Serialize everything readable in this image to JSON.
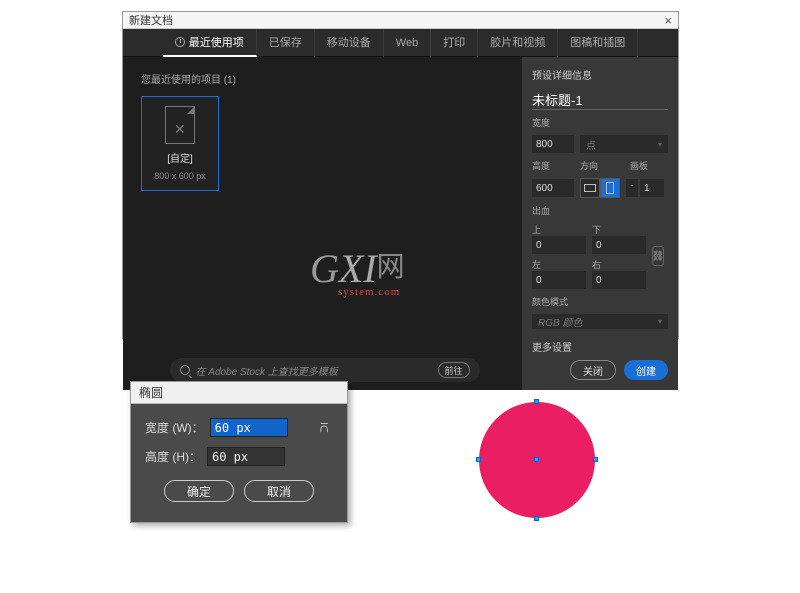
{
  "dialog": {
    "title": "新建文档",
    "close": "×",
    "tabs": {
      "recent": "最近使用项",
      "saved": "已保存",
      "mobile": "移动设备",
      "web": "Web",
      "print": "打印",
      "film": "胶片和视频",
      "art": "图稿和插图"
    },
    "recent_label": "您最近使用的项目 (1)",
    "preset": {
      "name": "[自定]",
      "dim": "800 x 600 px"
    },
    "search": {
      "placeholder": "在 Adobe Stock 上查找更多模板",
      "go": "前往"
    },
    "details": {
      "section": "预设详细信息",
      "name": "未标题-1",
      "width_lbl": "宽度",
      "width": "800",
      "unit": "点",
      "height_lbl": "高度",
      "height": "600",
      "orient_lbl": "方向",
      "artboards_lbl": "画板",
      "artboards": "1",
      "bleed_lbl": "出血",
      "top_lbl": "上",
      "bottom_lbl": "下",
      "left_lbl": "左",
      "right_lbl": "右",
      "top": "0",
      "bottom": "0",
      "left": "0",
      "right": "0",
      "colormode_lbl": "颜色模式",
      "colormode": "RGB 颜色",
      "more": "更多设置"
    },
    "buttons": {
      "close": "关闭",
      "create": "创建"
    }
  },
  "ellipse": {
    "title": "椭圆",
    "width_lbl": "宽度 (W)：",
    "width": "60 px",
    "height_lbl": "高度 (H)：",
    "height": "60 px",
    "ok": "确定",
    "cancel": "取消"
  },
  "watermark": {
    "brand1": "G",
    "brand2": "XI",
    "wang": "网",
    "sys": "system.com"
  },
  "shape": {
    "color": "#e91e63"
  }
}
